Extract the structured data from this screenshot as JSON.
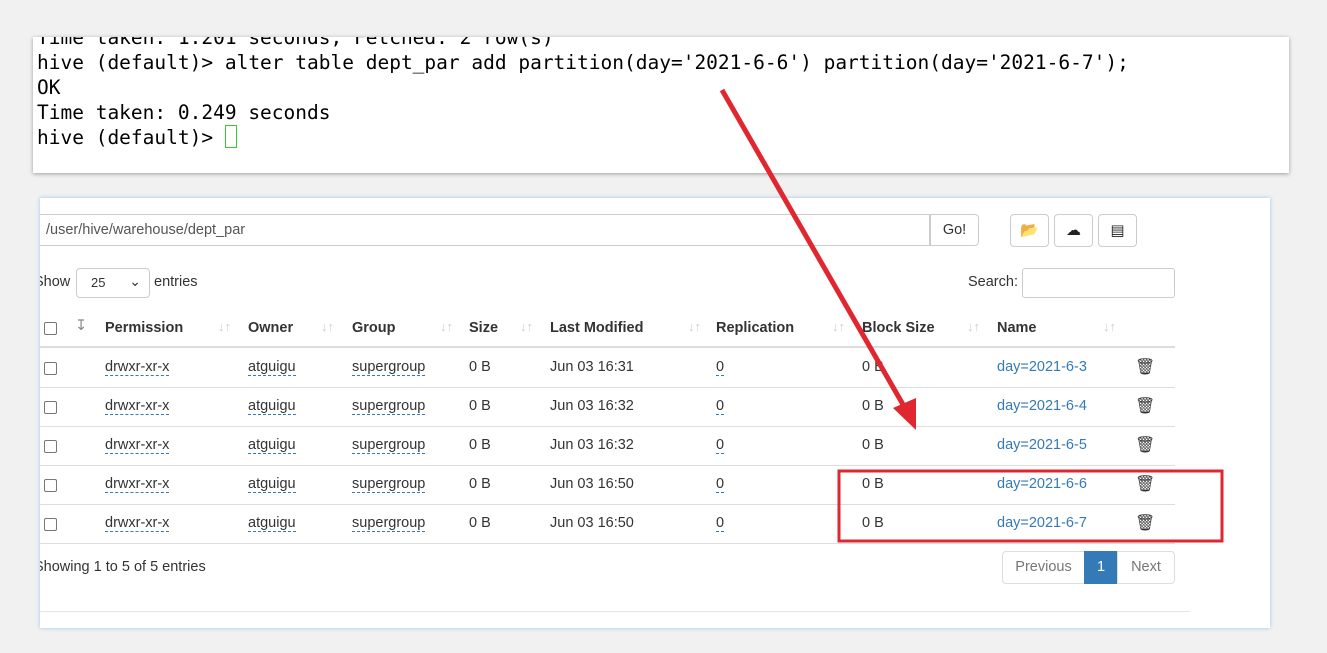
{
  "terminal": {
    "lines": [
      "Time taken: 1.201 seconds, Fetched: 2 row(s)",
      "hive (default)> alter table dept_par add partition(day='2021-6-6') partition(day='2021-6-7');",
      "OK",
      "Time taken: 0.249 seconds"
    ],
    "prompt": "hive (default)> "
  },
  "browser": {
    "path": "/user/hive/warehouse/dept_par",
    "go_label": "Go!",
    "show_label": "Show",
    "page_size": "25",
    "entries_label": "entries",
    "search_label": "Search:",
    "search_value": "",
    "columns": [
      "Permission",
      "Owner",
      "Group",
      "Size",
      "Last Modified",
      "Replication",
      "Block Size",
      "Name"
    ],
    "rows": [
      {
        "permission": "drwxr-xr-x",
        "owner": "atguigu",
        "group": "supergroup",
        "size": "0 B",
        "modified": "Jun 03 16:31",
        "replication": "0",
        "block": "0 B",
        "name": "day=2021-6-3"
      },
      {
        "permission": "drwxr-xr-x",
        "owner": "atguigu",
        "group": "supergroup",
        "size": "0 B",
        "modified": "Jun 03 16:32",
        "replication": "0",
        "block": "0 B",
        "name": "day=2021-6-4"
      },
      {
        "permission": "drwxr-xr-x",
        "owner": "atguigu",
        "group": "supergroup",
        "size": "0 B",
        "modified": "Jun 03 16:32",
        "replication": "0",
        "block": "0 B",
        "name": "day=2021-6-5"
      },
      {
        "permission": "drwxr-xr-x",
        "owner": "atguigu",
        "group": "supergroup",
        "size": "0 B",
        "modified": "Jun 03 16:50",
        "replication": "0",
        "block": "0 B",
        "name": "day=2021-6-6"
      },
      {
        "permission": "drwxr-xr-x",
        "owner": "atguigu",
        "group": "supergroup",
        "size": "0 B",
        "modified": "Jun 03 16:50",
        "replication": "0",
        "block": "0 B",
        "name": "day=2021-6-7"
      }
    ],
    "info": "Showing 1 to 5 of 5 entries",
    "pagination": {
      "previous": "Previous",
      "current": "1",
      "next": "Next"
    }
  },
  "colors": {
    "accent": "#337ab7",
    "annotation": "#e0262f"
  }
}
